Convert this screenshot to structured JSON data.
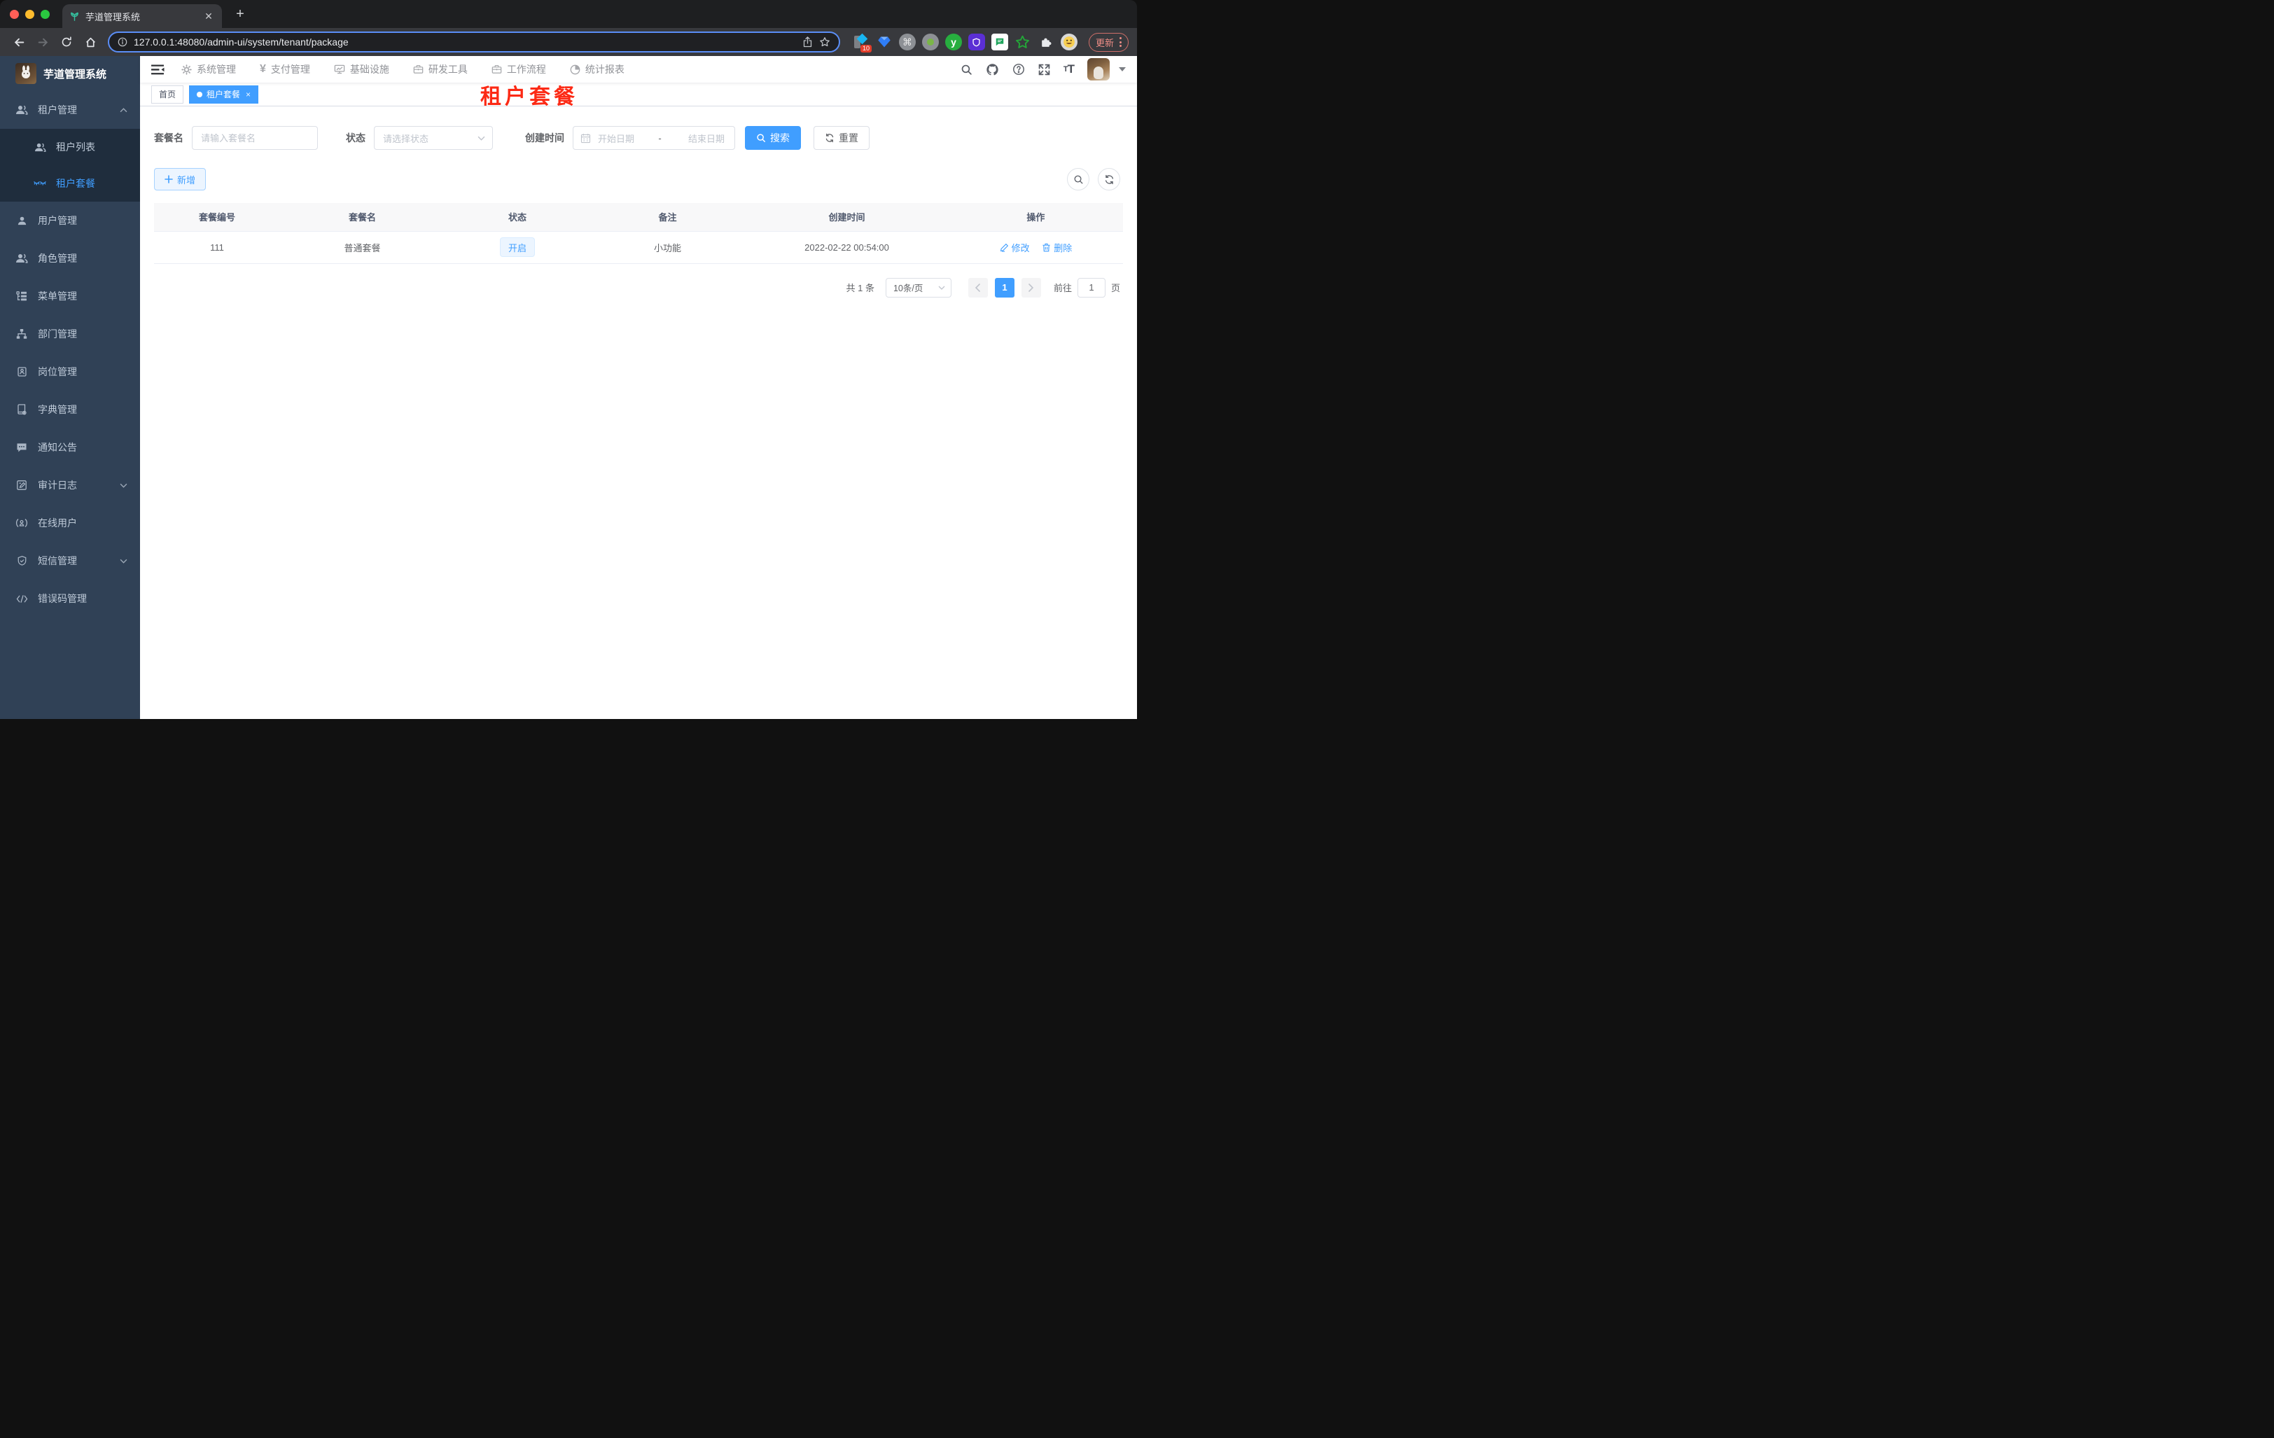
{
  "colors": {
    "accent": "#409eff",
    "sidebar_bg": "#304156",
    "submenu_bg": "#1f2d3d",
    "red_title": "#fc2a15",
    "status_tag_bg": "#ecf5ff",
    "update_button": "#ee8d86"
  },
  "browser": {
    "tab_title": "芋道管理系统",
    "url": "127.0.0.1:48080/admin-ui/system/tenant/package",
    "update_button": "更新",
    "extension_badge": "10"
  },
  "header": {
    "nav": [
      {
        "label": "系统管理",
        "icon": "gear-icon"
      },
      {
        "label": "支付管理",
        "icon": "yen-icon"
      },
      {
        "label": "基础设施",
        "icon": "monitor-icon"
      },
      {
        "label": "研发工具",
        "icon": "briefcase-icon"
      },
      {
        "label": "工作流程",
        "icon": "briefcase-icon"
      },
      {
        "label": "统计报表",
        "icon": "pie-icon"
      }
    ],
    "yen_glyph": "¥"
  },
  "sidebar": {
    "logo_title": "芋道管理系统",
    "items": [
      {
        "label": "租户管理",
        "icon": "users-icon",
        "expanded": true
      },
      {
        "label": "租户列表",
        "icon": "users-icon",
        "sub": true
      },
      {
        "label": "租户套餐",
        "icon": "package-icon",
        "sub": true,
        "active": true
      },
      {
        "label": "用户管理",
        "icon": "user-icon"
      },
      {
        "label": "角色管理",
        "icon": "users-icon"
      },
      {
        "label": "菜单管理",
        "icon": "tree-icon"
      },
      {
        "label": "部门管理",
        "icon": "org-icon"
      },
      {
        "label": "岗位管理",
        "icon": "badge-icon"
      },
      {
        "label": "字典管理",
        "icon": "book-icon"
      },
      {
        "label": "通知公告",
        "icon": "message-icon"
      },
      {
        "label": "审计日志",
        "icon": "log-icon",
        "expandable": true
      },
      {
        "label": "在线用户",
        "icon": "online-icon"
      },
      {
        "label": "短信管理",
        "icon": "shield-icon",
        "expandable": true
      },
      {
        "label": "错误码管理",
        "icon": "code-icon"
      }
    ]
  },
  "tags": {
    "home": "首页",
    "active": "租户套餐"
  },
  "page_title_overlay": "租户套餐",
  "filters": {
    "name_label": "套餐名",
    "name_placeholder": "请输入套餐名",
    "status_label": "状态",
    "status_placeholder": "请选择状态",
    "date_label": "创建时间",
    "date_start_placeholder": "开始日期",
    "date_separator": "-",
    "date_end_placeholder": "结束日期",
    "search_button": "搜索",
    "reset_button": "重置",
    "add_button": "新增"
  },
  "table": {
    "columns": [
      "套餐编号",
      "套餐名",
      "状态",
      "备注",
      "创建时间",
      "操作"
    ],
    "rows": [
      {
        "id": "111",
        "name": "普通套餐",
        "status": "开启",
        "remark": "小功能",
        "created": "2022-02-22 00:54:00",
        "edit": "修改",
        "delete": "删除"
      }
    ]
  },
  "pagination": {
    "total": "共 1 条",
    "per_page": "10条/页",
    "current": "1",
    "goto_label": "前往",
    "goto_value": "1",
    "page_suffix": "页"
  }
}
